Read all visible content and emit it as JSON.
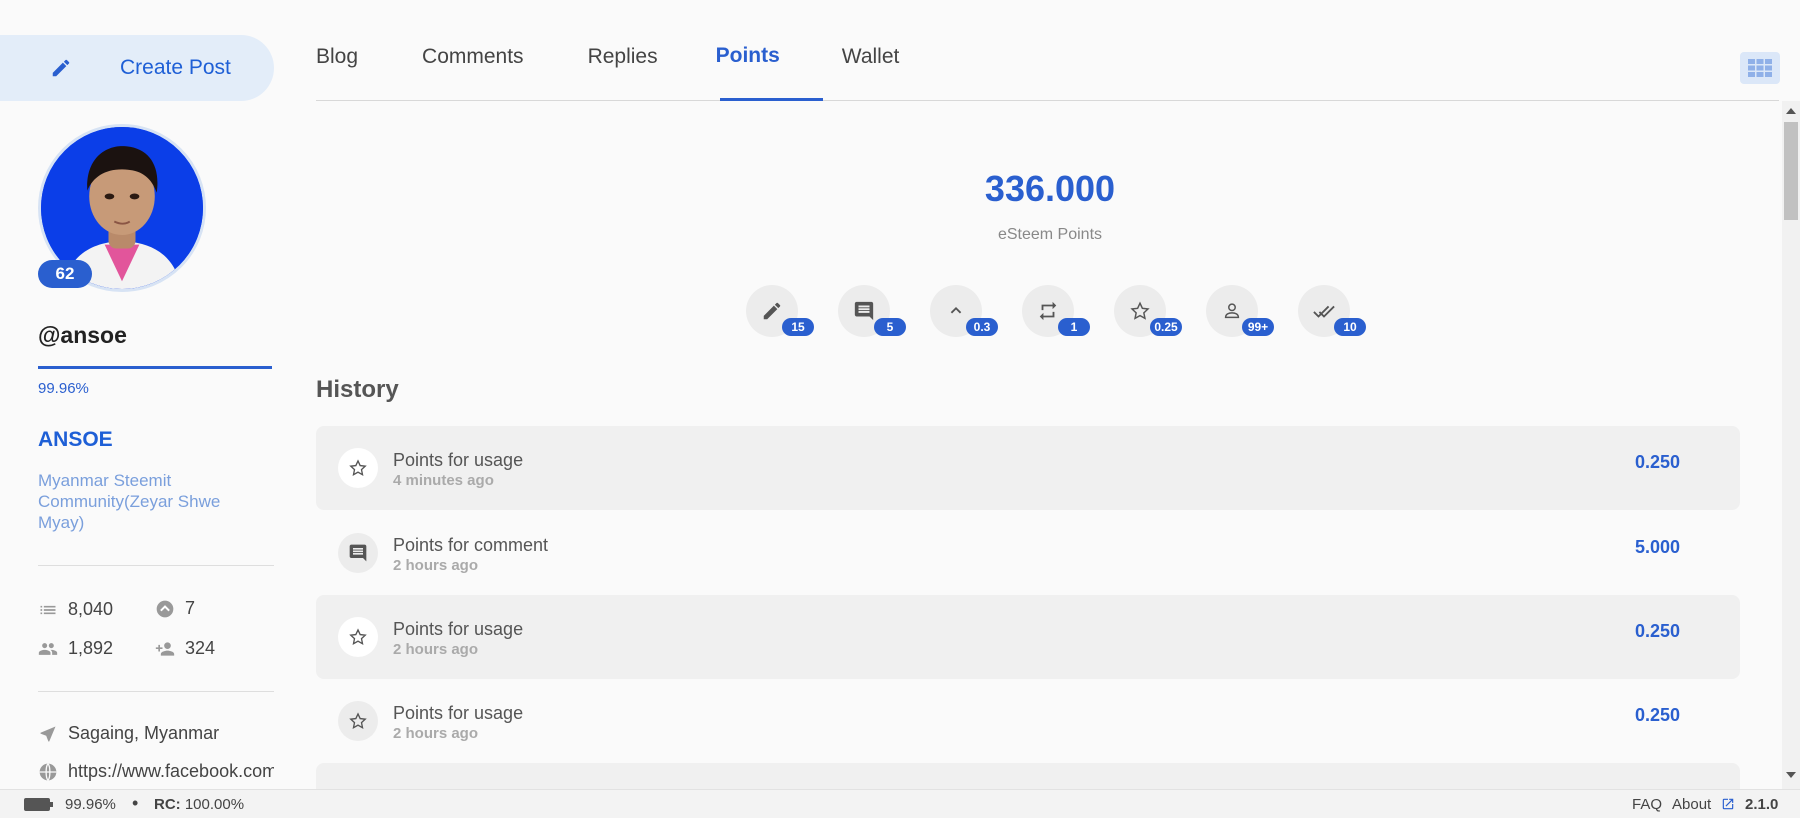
{
  "sidebar": {
    "create_post_label": "Create Post",
    "reputation": "62",
    "username": "@ansoe",
    "voting_power_text": "99.96%",
    "voting_power_fraction": 0.9996,
    "display_name": "ANSOE",
    "about": "Myanmar Steemit Community(Zeyar Shwe Myay)",
    "stats": {
      "posts": "8,040",
      "votes": "7",
      "followers": "1,892",
      "following": "324"
    },
    "location": "Sagaing, Myanmar",
    "website": "https://www.facebook.com/"
  },
  "tabs": [
    {
      "label": "Blog",
      "active": false
    },
    {
      "label": "Comments",
      "active": false
    },
    {
      "label": "Replies",
      "active": false
    },
    {
      "label": "Points",
      "active": true
    },
    {
      "label": "Wallet",
      "active": false
    }
  ],
  "points": {
    "value": "336.000",
    "label": "eSteem Points",
    "actions": [
      {
        "icon": "pencil-icon",
        "badge": "15"
      },
      {
        "icon": "comment-icon",
        "badge": "5"
      },
      {
        "icon": "chevron-up-icon",
        "badge": "0.3"
      },
      {
        "icon": "repeat-icon",
        "badge": "1"
      },
      {
        "icon": "star-icon",
        "badge": "0.25"
      },
      {
        "icon": "person-icon",
        "badge": "99+"
      },
      {
        "icon": "double-check-icon",
        "badge": "10"
      }
    ]
  },
  "history": {
    "title": "History",
    "items": [
      {
        "icon": "star-icon",
        "title": "Points for usage",
        "time": "4 minutes ago",
        "amount": "0.250"
      },
      {
        "icon": "comment-icon",
        "title": "Points for comment",
        "time": "2 hours ago",
        "amount": "5.000"
      },
      {
        "icon": "star-icon",
        "title": "Points for usage",
        "time": "2 hours ago",
        "amount": "0.250"
      },
      {
        "icon": "star-icon",
        "title": "Points for usage",
        "time": "2 hours ago",
        "amount": "0.250"
      }
    ]
  },
  "footer": {
    "voting_power": "99.96%",
    "rc_label": "RC:",
    "rc_value": "100.00%",
    "faq": "FAQ",
    "about": "About",
    "version": "2.1.0"
  },
  "colors": {
    "accent": "#2a5fcf",
    "accent_light": "#e3edf9",
    "row_shade": "#f0f0f0"
  }
}
